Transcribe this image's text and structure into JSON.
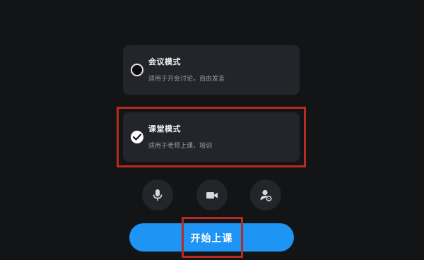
{
  "modes": [
    {
      "title": "会议模式",
      "description": "适用于开会讨论，自由发言",
      "selected": false
    },
    {
      "title": "课堂模式",
      "description": "适用于老师上课，培训",
      "selected": true
    }
  ],
  "controls": [
    {
      "icon": "microphone-icon"
    },
    {
      "icon": "video-camera-icon"
    },
    {
      "icon": "user-settings-icon"
    }
  ],
  "start_button": {
    "label": "开始上课",
    "color": "#1e94f5"
  },
  "colors": {
    "background": "#131416",
    "card": "#23252a",
    "highlight": "#b82a20"
  }
}
